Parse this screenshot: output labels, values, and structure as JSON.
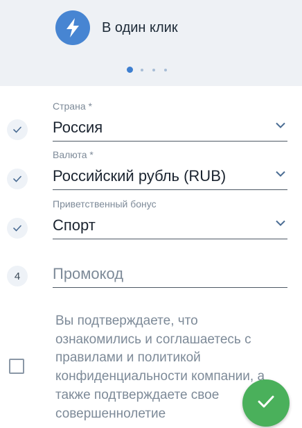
{
  "header": {
    "registration_type": "В один клик",
    "icon": "lightning-bolt-icon",
    "accent_color": "#4785d2",
    "pager": {
      "total": 4,
      "active": 1
    }
  },
  "form": {
    "country": {
      "label": "Страна *",
      "value": "Россия"
    },
    "currency": {
      "label": "Валюта *",
      "value": "Российский рубль (RUB)"
    },
    "bonus": {
      "label": "Приветственный бонус",
      "value": "Спорт"
    },
    "promo": {
      "step": "4",
      "placeholder": "Промокод"
    }
  },
  "agreement": {
    "text": "Вы подтверждаете, что ознакомились и соглашаетесь с правилами и политикой конфиденциальности компании, а также подтверждаете свое совершеннолетие",
    "checked": false
  },
  "submit": {
    "icon": "checkmark-icon",
    "color": "#4ab05b"
  }
}
